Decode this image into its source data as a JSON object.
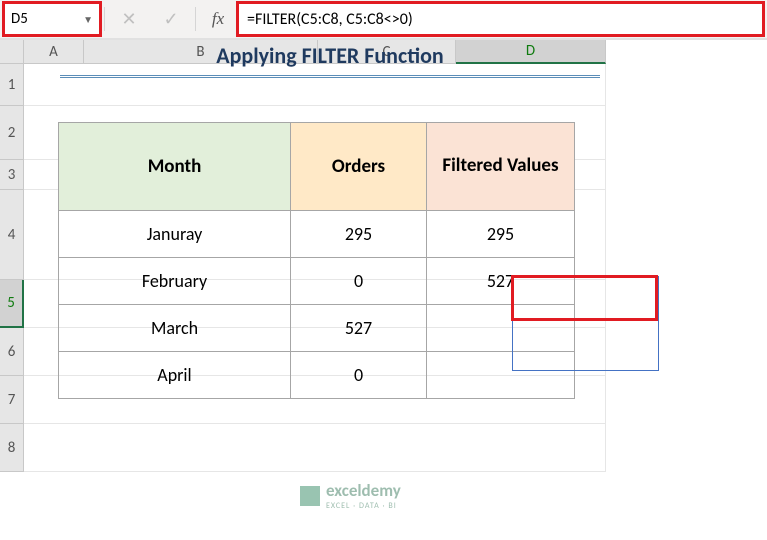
{
  "namebox": {
    "value": "D5"
  },
  "formula_bar": {
    "cancel_glyph": "✕",
    "enter_glyph": "✓",
    "fx_label": "fx",
    "formula": "=FILTER(C5:C8, C5:C8<>0)"
  },
  "columns": [
    "A",
    "B",
    "C",
    "D"
  ],
  "rows": [
    "1",
    "2",
    "3",
    "4",
    "5",
    "6",
    "7",
    "8"
  ],
  "active_col_index": 3,
  "active_row_index": 4,
  "title": "Applying FILTER Function",
  "headers": {
    "month": "Month",
    "orders": "Orders",
    "filtered": "Filtered Values"
  },
  "table": [
    {
      "month": "Januray",
      "orders": "295",
      "filtered": "295"
    },
    {
      "month": "February",
      "orders": "0",
      "filtered": "527"
    },
    {
      "month": "March",
      "orders": "527",
      "filtered": ""
    },
    {
      "month": "April",
      "orders": "0",
      "filtered": ""
    }
  ],
  "watermark": {
    "brand": "exceldemy",
    "sub": "EXCEL · DATA · BI"
  },
  "chart_data": {
    "type": "table",
    "title": "Applying FILTER Function",
    "columns": [
      "Month",
      "Orders",
      "Filtered Values"
    ],
    "rows": [
      [
        "Januray",
        295,
        295
      ],
      [
        "February",
        0,
        527
      ],
      [
        "March",
        527,
        null
      ],
      [
        "April",
        0,
        null
      ]
    ],
    "formula_cell": {
      "ref": "D5",
      "formula": "=FILTER(C5:C8, C5:C8<>0)"
    }
  }
}
